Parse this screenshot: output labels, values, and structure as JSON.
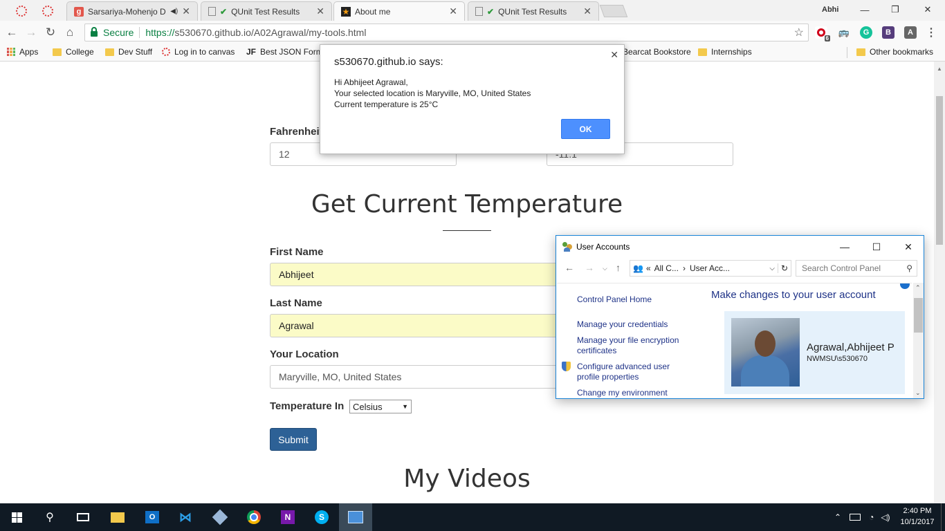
{
  "browser": {
    "tabs": [
      {
        "title": "Sarsariya-Mohenjo Da",
        "favicon": "g-icon",
        "has_audio": true
      },
      {
        "title": "QUnit Test Results",
        "favicon": "check-icon"
      },
      {
        "title": "About me",
        "favicon": "star-icon",
        "active": true
      },
      {
        "title": "QUnit Test Results",
        "favicon": "check-icon"
      }
    ],
    "profile_name": "Abhi",
    "secure_label": "Secure",
    "url_scheme": "https://",
    "url_host": "s530670.github.io",
    "url_path": "/A02Agrawal/my-tools.html",
    "extension_badge": "6",
    "bookmarks": [
      "Apps",
      "College",
      "Dev Stuff",
      "Log in to canvas",
      "Best JSON Form",
      "Bearcat Bookstore",
      "Internships"
    ],
    "other_bookmarks": "Other bookmarks"
  },
  "page": {
    "fahrenheit_label": "Fahrenheit",
    "fahrenheit_value": "12",
    "celsius_value": "-11.1",
    "section_title": "Get Current Temperature",
    "first_name_label": "First Name",
    "first_name_value": "Abhijeet",
    "last_name_label": "Last Name",
    "last_name_value": "Agrawal",
    "location_label": "Your Location",
    "location_value": "Maryville, MO, United States",
    "temp_in_label": "Temperature In",
    "temp_unit_selected": "Celsius",
    "submit_label": "Submit",
    "videos_title": "My Videos"
  },
  "alert": {
    "title": "s530670.github.io says:",
    "line1": "Hi Abhijeet Agrawal,",
    "line2": "Your selected location is Maryville, MO, United States",
    "line3": "Current temperature is 25°C",
    "ok_label": "OK"
  },
  "user_accounts": {
    "window_title": "User Accounts",
    "path_prefix": "«",
    "path_part1": "All C...",
    "path_part2": "User Acc...",
    "search_placeholder": "Search Control Panel",
    "links": [
      "Control Panel Home",
      "Manage your credentials",
      "Manage your file encryption certificates",
      "Configure advanced user profile properties",
      "Change my environment"
    ],
    "heading": "Make changes to your user account",
    "account_name": "Agrawal,Abhijeet P",
    "account_domain": "NWMSU\\s530670"
  },
  "taskbar": {
    "time": "2:40 PM",
    "date": "10/1/2017"
  },
  "colors": {
    "accent_blue": "#4d90fe",
    "submit_blue": "#2d6196",
    "autofill_yellow": "#fbfbc7",
    "link_blue": "#1e3287",
    "taskbar": "#101a24"
  }
}
